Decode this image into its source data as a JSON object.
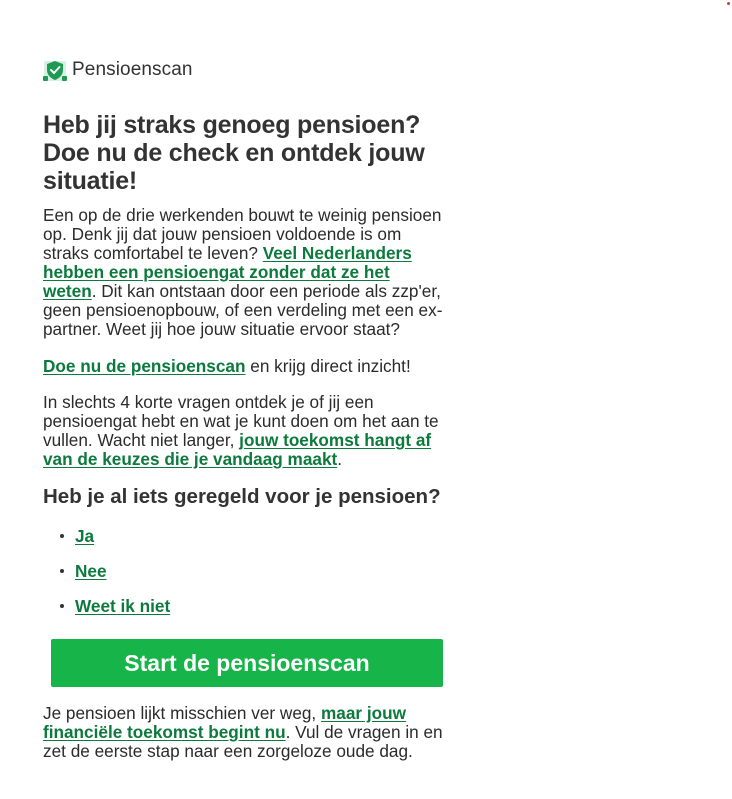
{
  "colors": {
    "brand_green": "#0c7a3d",
    "cta_green": "#17b449",
    "text": "#2b2b2b",
    "heading": "#333333"
  },
  "brand": {
    "logo_icon": "pension-shield-icon",
    "name": "Pensioenscan"
  },
  "headline": "Heb jij straks genoeg pensioen? Doe nu de check en ontdek jouw situatie!",
  "intro": {
    "text_1": "Een op de drie werkenden bouwt te weinig pensioen op. Denk jij dat jouw pensioen voldoende is om straks comfortabel te leven? ",
    "link_1": "Veel Nederlanders hebben een pensioengat zonder dat ze het weten",
    "text_2": ". Dit kan ontstaan door een periode als zzp'er, geen pensioenopbouw, of een verdeling met een ex-partner. Weet jij hoe jouw situatie ervoor staat?"
  },
  "cta_line": {
    "link": "Doe nu de pensioenscan",
    "text": " en krijg direct inzicht!"
  },
  "explain": {
    "text_1": "In slechts 4 korte vragen ontdek je of jij een pensioengat hebt en wat je kunt doen om het aan te vullen. Wacht niet langer, ",
    "link": "jouw toekomst hangt af van de keuzes die je vandaag maakt",
    "text_2": "."
  },
  "question": {
    "title": "Heb je al iets geregeld voor je pensioen?",
    "options": [
      "Ja",
      "Nee",
      "Weet ik niet"
    ]
  },
  "start_button": "Start de pensioenscan",
  "footer": {
    "text_1": "Je pensioen lijkt misschien ver weg, ",
    "link": "maar jouw financiële toekomst begint nu",
    "text_2": ". Vul de vragen in en zet de eerste stap naar een zorgeloze oude dag."
  }
}
